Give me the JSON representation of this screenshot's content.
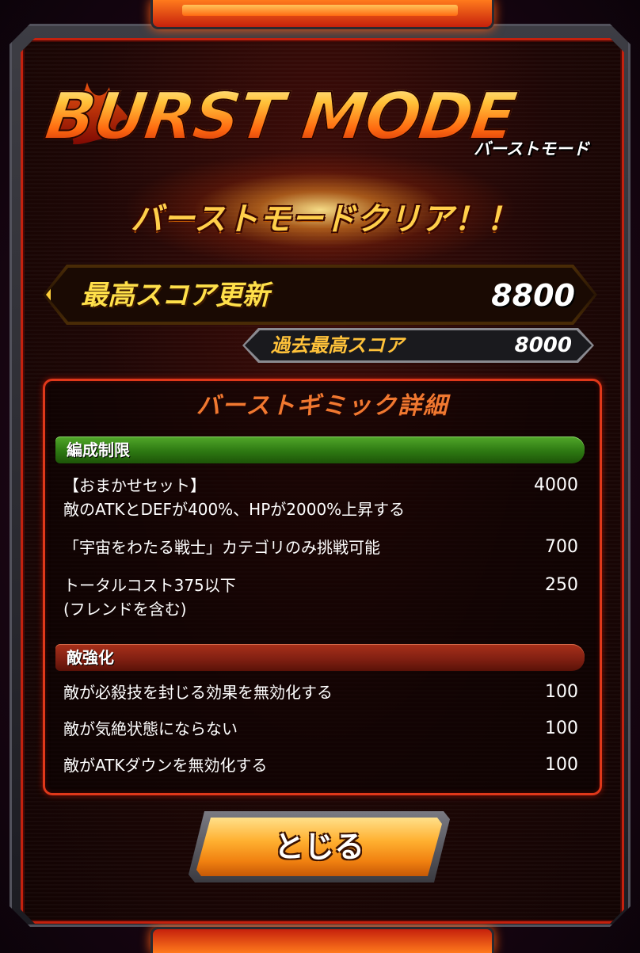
{
  "header": {
    "title": "BURST MODE",
    "subtitle": "バーストモード",
    "clear_message": "バーストモードクリア！！"
  },
  "scores": {
    "best_label": "最高スコア更新",
    "best_value": "8800",
    "past_label": "過去最高スコア",
    "past_value": "8000"
  },
  "details": {
    "title": "バーストギミック詳細",
    "sections": [
      {
        "label": "編成制限",
        "rows": [
          {
            "lines": [
              "【おまかせセット】",
              "敵のATKとDEFが400%、HPが2000%上昇する"
            ],
            "value": "4000"
          },
          {
            "lines": [
              "「宇宙をわたる戦士」カテゴリのみ挑戦可能"
            ],
            "value": "700"
          },
          {
            "lines": [
              "トータルコスト375以下",
              "(フレンドを含む)"
            ],
            "value": "250"
          }
        ]
      },
      {
        "label": "敵強化",
        "rows": [
          {
            "lines": [
              "敵が必殺技を封じる効果を無効化する"
            ],
            "value": "100"
          },
          {
            "lines": [
              "敵が気絶状態にならない"
            ],
            "value": "100"
          },
          {
            "lines": [
              "敵がATKダウンを無効化する"
            ],
            "value": "100"
          }
        ]
      }
    ]
  },
  "close_button": {
    "label": "とじる"
  },
  "colors": {
    "accent_red": "#c4210e",
    "gold": "#ffcf3a",
    "section_green": "#2d7812",
    "section_red": "#822012"
  }
}
